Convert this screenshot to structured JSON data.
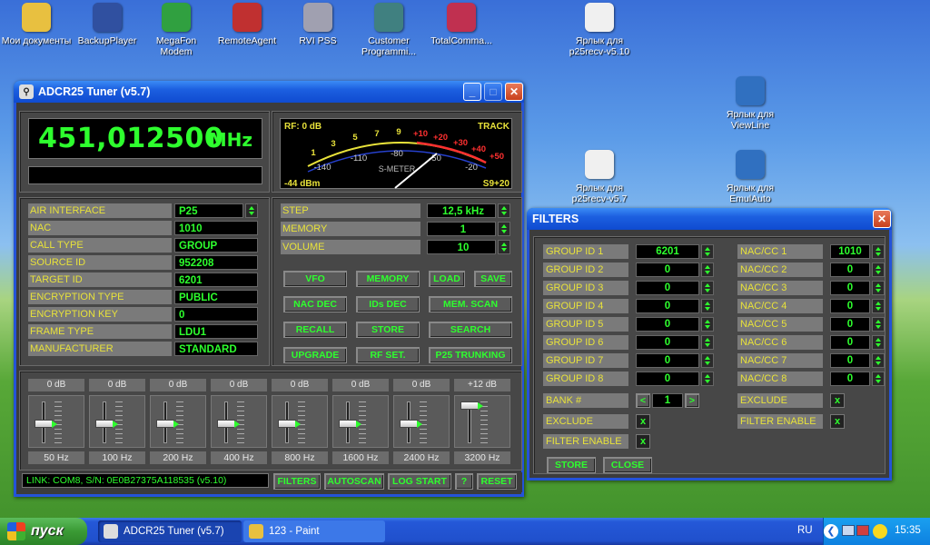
{
  "desktop": {
    "icons": [
      {
        "label": "Мои документы",
        "icon": "folder-icon",
        "color": "#e8c040"
      },
      {
        "label": "BackupPlayer",
        "icon": "backup-player-icon",
        "color": "#3050a0"
      },
      {
        "label": "MegaFon Modem",
        "icon": "modem-icon",
        "color": "#30a040"
      },
      {
        "label": "RemoteAgent",
        "icon": "remote-agent-icon",
        "color": "#c03030"
      },
      {
        "label": "RVI PSS",
        "icon": "camera-icon",
        "color": "#a0a0b0"
      },
      {
        "label": "Customer Programmi...",
        "icon": "programming-icon",
        "color": "#408080"
      },
      {
        "label": "TotalComma...",
        "icon": "floppy-icon",
        "color": "#c03050"
      },
      {
        "label": "Ярлык для p25recv-v5.10",
        "icon": "antenna-icon",
        "color": "#f0f0f0"
      },
      {
        "label": "Ярлык для ViewLine",
        "icon": "torch-icon",
        "color": "#3070c0"
      },
      {
        "label": "Ярлык для p25recv-v5.7",
        "icon": "antenna-icon",
        "color": "#f0f0f0"
      },
      {
        "label": "Ярлык для EmulAuto",
        "icon": "torch-icon",
        "color": "#3070c0"
      }
    ]
  },
  "tuner": {
    "title": "ADCR25 Tuner (v5.7)",
    "frequency": "451,012500",
    "unit": "MHz",
    "meter": {
      "rf": "RF: 0 dB",
      "track": "TRACK",
      "dbm": "-44 dBm",
      "level": "S9+20",
      "label": "S-METER",
      "scale_top": [
        "1",
        "3",
        "5",
        "7",
        "9",
        "+10",
        "+20",
        "+30",
        "+40",
        "+50"
      ],
      "scale_bottom": [
        "-140",
        "-110",
        "-80",
        "-50",
        "-20"
      ]
    },
    "info": [
      {
        "label": "AIR INTERFACE",
        "value": "P25"
      },
      {
        "label": "NAC",
        "value": "1010"
      },
      {
        "label": "CALL TYPE",
        "value": "GROUP"
      },
      {
        "label": "SOURCE ID",
        "value": "952208"
      },
      {
        "label": "TARGET ID",
        "value": "6201"
      },
      {
        "label": "ENCRYPTION TYPE",
        "value": "PUBLIC"
      },
      {
        "label": "ENCRYPTION KEY",
        "value": "0"
      },
      {
        "label": "FRAME TYPE",
        "value": "LDU1"
      },
      {
        "label": "MANUFACTURER",
        "value": "STANDARD"
      }
    ],
    "settings": [
      {
        "label": "STEP",
        "value": "12,5 kHz"
      },
      {
        "label": "MEMORY",
        "value": "1"
      },
      {
        "label": "VOLUME",
        "value": "10"
      }
    ],
    "buttons": {
      "vfo": "VFO",
      "memory": "MEMORY",
      "load": "LOAD",
      "save": "SAVE",
      "nac_dec": "NAC DEC",
      "ids_dec": "IDs DEC",
      "mem_scan": "MEM. SCAN",
      "recall": "RECALL",
      "store": "STORE",
      "search": "SEARCH",
      "upgrade": "UPGRADE",
      "rf_set": "RF SET.",
      "p25_trunking": "P25 TRUNKING"
    },
    "eq": [
      {
        "gain": "0 dB",
        "freq": "50 Hz",
        "level": 0.5
      },
      {
        "gain": "0 dB",
        "freq": "100 Hz",
        "level": 0.5
      },
      {
        "gain": "0 dB",
        "freq": "200 Hz",
        "level": 0.5
      },
      {
        "gain": "0 dB",
        "freq": "400 Hz",
        "level": 0.5
      },
      {
        "gain": "0 dB",
        "freq": "800 Hz",
        "level": 0.5
      },
      {
        "gain": "0 dB",
        "freq": "1600 Hz",
        "level": 0.5
      },
      {
        "gain": "0 dB",
        "freq": "2400 Hz",
        "level": 0.5
      },
      {
        "gain": "+12 dB",
        "freq": "3200 Hz",
        "level": 1.0
      }
    ],
    "status": "LINK: COM8, S/N: 0E0B27375A118535 (v5.10)",
    "bottom_buttons": {
      "filters": "FILTERS",
      "autoscan": "AUTOSCAN",
      "log_start": "LOG START",
      "help": "?",
      "reset": "RESET"
    }
  },
  "filters": {
    "title": "FILTERS",
    "groups": [
      {
        "label": "GROUP ID 1",
        "value": "6201"
      },
      {
        "label": "GROUP ID 2",
        "value": "0"
      },
      {
        "label": "GROUP ID 3",
        "value": "0"
      },
      {
        "label": "GROUP ID 4",
        "value": "0"
      },
      {
        "label": "GROUP ID 5",
        "value": "0"
      },
      {
        "label": "GROUP ID 6",
        "value": "0"
      },
      {
        "label": "GROUP ID 7",
        "value": "0"
      },
      {
        "label": "GROUP ID 8",
        "value": "0"
      }
    ],
    "nacs": [
      {
        "label": "NAC/CC 1",
        "value": "1010"
      },
      {
        "label": "NAC/CC 2",
        "value": "0"
      },
      {
        "label": "NAC/CC 3",
        "value": "0"
      },
      {
        "label": "NAC/CC 4",
        "value": "0"
      },
      {
        "label": "NAC/CC 5",
        "value": "0"
      },
      {
        "label": "NAC/CC 6",
        "value": "0"
      },
      {
        "label": "NAC/CC 7",
        "value": "0"
      },
      {
        "label": "NAC/CC 8",
        "value": "0"
      }
    ],
    "bank_label": "BANK #",
    "bank_value": "1",
    "bank_prev": "<",
    "bank_next": ">",
    "exclude_label": "EXCLUDE",
    "filter_enable_label": "FILTER ENABLE",
    "check_mark": "x",
    "store": "STORE",
    "close": "CLOSE"
  },
  "taskbar": {
    "start": "пуск",
    "tasks": [
      {
        "label": "ADCR25 Tuner (v5.7)",
        "active": true
      },
      {
        "label": "123 - Paint",
        "active": false
      }
    ],
    "lang": "RU",
    "clock": "15:35"
  },
  "colors": {
    "lcd_green": "#2eff2e",
    "label_yellow": "#e8e23a",
    "xp_blue": "#2453d8"
  }
}
